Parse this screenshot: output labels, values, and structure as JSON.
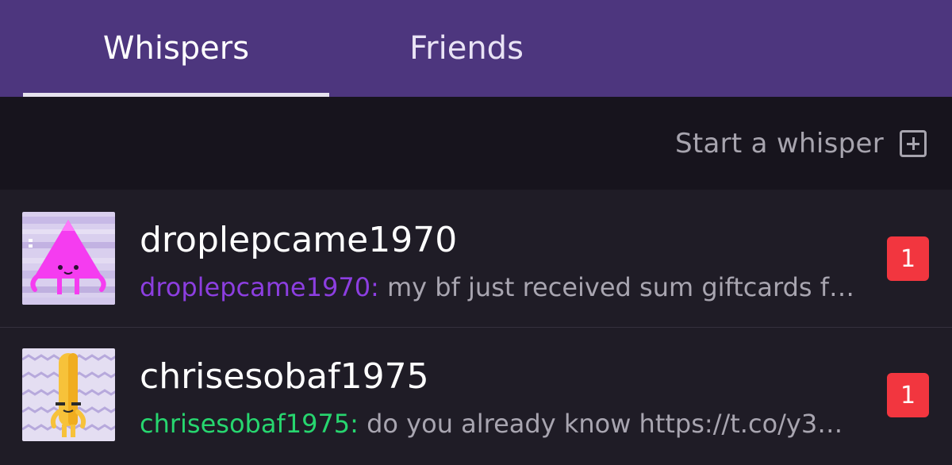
{
  "tabs": {
    "whispers_label": "Whispers",
    "friends_label": "Friends"
  },
  "toolbar": {
    "start_whisper_label": "Start a whisper",
    "start_whisper_icon": "plus-square-icon"
  },
  "conversations": [
    {
      "username": "droplepcame1970",
      "preview_sender": "droplepcame1970:",
      "preview_text": " my bf just received sum giftcards f…",
      "unread_count": "1",
      "sender_color": "#8c3ee0",
      "avatar_icon": "pink-triangle-glitch-avatar"
    },
    {
      "username": "chrisesobaf1975",
      "preview_sender": "chrisesobaf1975:",
      "preview_text": " do you already know https://t.co/y3…",
      "unread_count": "1",
      "sender_color": "#27d66f",
      "avatar_icon": "yellow-stick-glitch-avatar"
    }
  ],
  "colors": {
    "header_bg": "#4d367e",
    "toolbar_bg": "#17141d",
    "list_bg": "#1f1c26",
    "badge_bg": "#f2363f"
  }
}
